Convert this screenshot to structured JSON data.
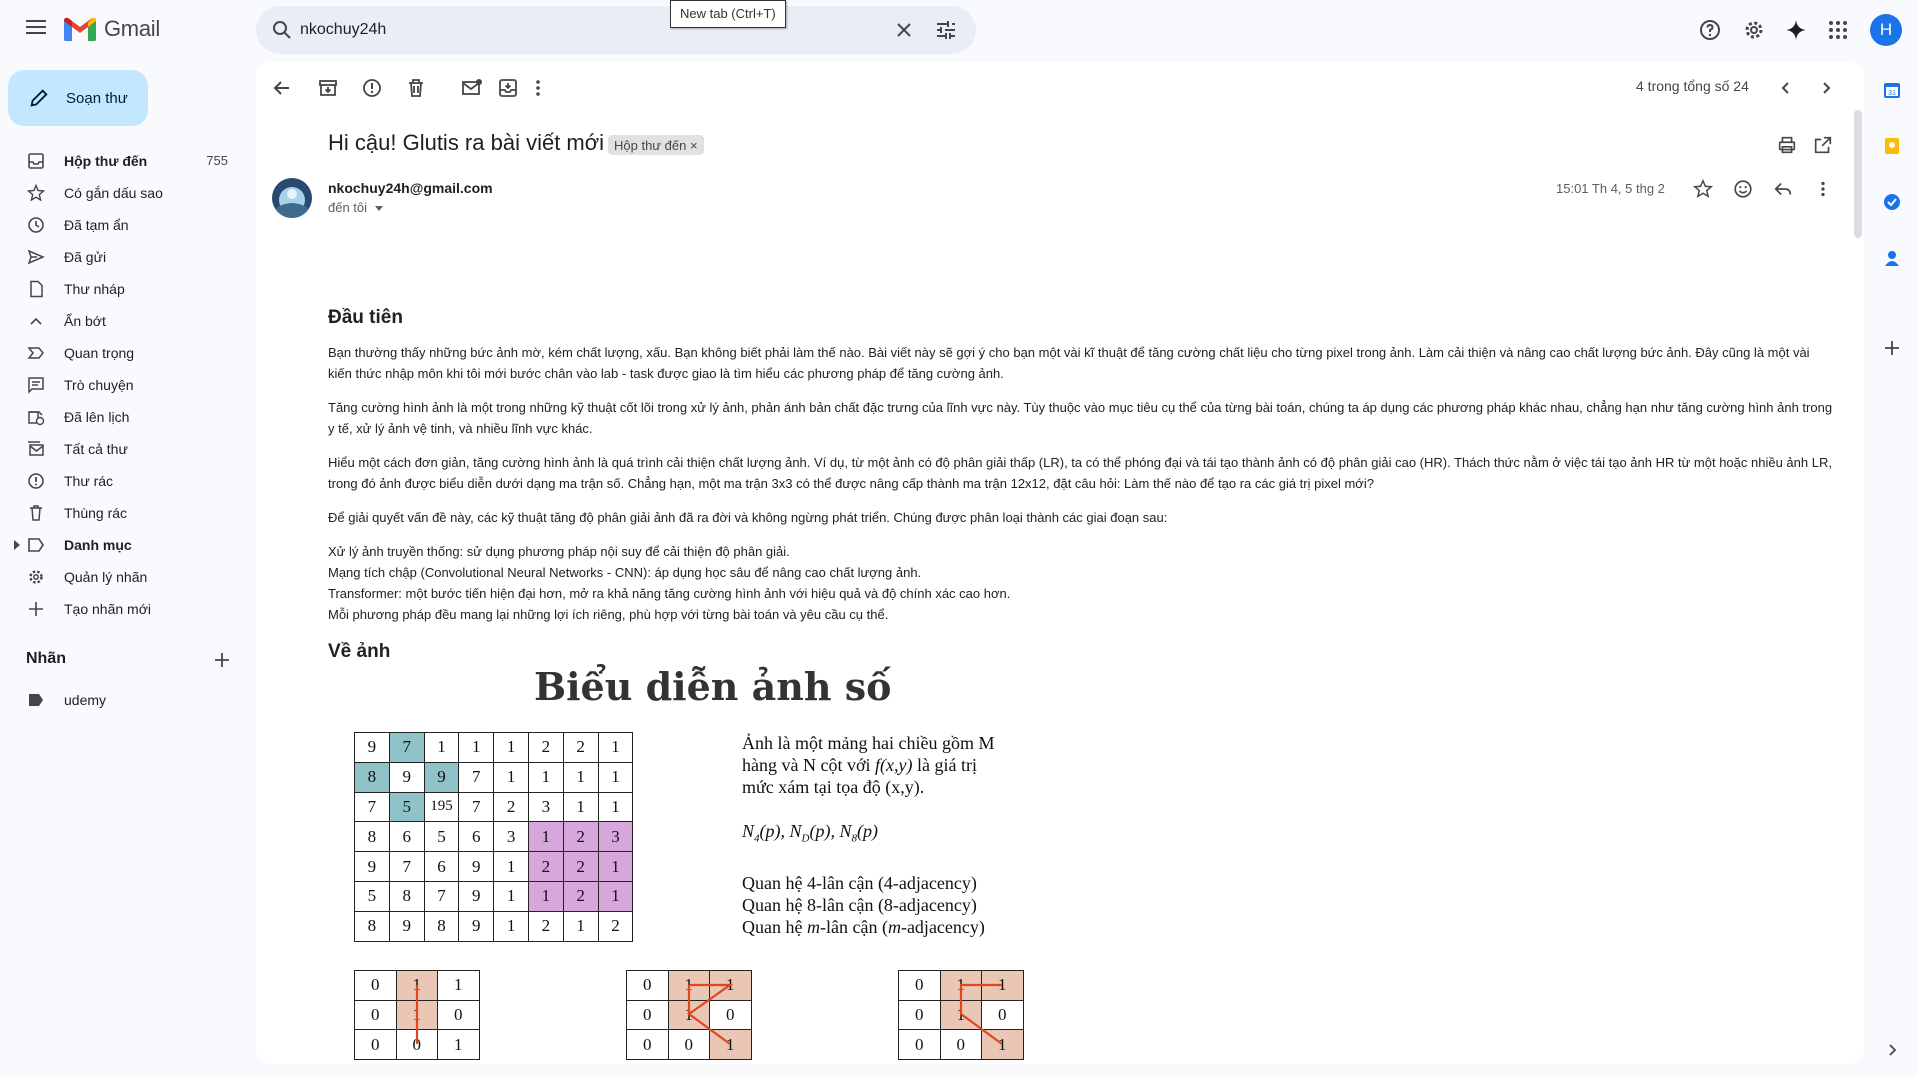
{
  "app": {
    "name": "Gmail"
  },
  "search": {
    "value": "nkochuy24h"
  },
  "tooltip": {
    "text": "New tab (Ctrl+T)"
  },
  "account": {
    "initial": "H"
  },
  "compose": {
    "label": "Soạn thư"
  },
  "nav": {
    "items": [
      {
        "label": "Hộp thư đến",
        "count": "755",
        "icon": "inbox-icon"
      },
      {
        "label": "Có gắn dấu sao",
        "icon": "star-icon"
      },
      {
        "label": "Đã tạm ẩn",
        "icon": "clock-icon"
      },
      {
        "label": "Đã gửi",
        "icon": "send-icon"
      },
      {
        "label": "Thư nháp",
        "icon": "draft-icon"
      },
      {
        "label": "Ẩn bớt",
        "icon": "chevron-up-icon"
      },
      {
        "label": "Quan trọng",
        "icon": "important-icon"
      },
      {
        "label": "Trò chuyện",
        "icon": "chat-icon"
      },
      {
        "label": "Đã lên lịch",
        "icon": "scheduled-icon"
      },
      {
        "label": "Tất cả thư",
        "icon": "all-mail-icon"
      },
      {
        "label": "Thư rác",
        "icon": "spam-icon"
      },
      {
        "label": "Thùng rác",
        "icon": "trash-icon"
      },
      {
        "label": "Danh mục",
        "icon": "label-icon"
      },
      {
        "label": "Quản lý nhãn",
        "icon": "gear-icon"
      },
      {
        "label": "Tạo nhãn mới",
        "icon": "plus-icon"
      }
    ]
  },
  "labels": {
    "heading": "Nhãn",
    "items": [
      {
        "label": "udemy"
      }
    ]
  },
  "toolbar": {
    "pager": "4 trong tổng số 24"
  },
  "email": {
    "subject": "Hi cậu! Glutis ra bài viết mới",
    "chip": "Hộp thư đến",
    "chip_close": "×",
    "sender": "nkochuy24h@gmail.com",
    "to": "đến tôi",
    "date": "15:01 Th 4, 5 thg 2",
    "heading1": "Đầu tiên",
    "p1": "Bạn thường thấy những bức ảnh mờ, kém chất lượng, xấu. Bạn không biết phải làm thế nào. Bài viết này sẽ gợi ý cho bạn một vài kĩ thuật để tăng cường chất liệu cho từng pixel trong ảnh. Làm cải thiện và nâng cao chất lượng bức ảnh. Đây cũng là một vài kiến thức nhập môn khi tôi mới bước chân vào lab - task được giao là tìm hiểu các phương pháp để tăng cường ảnh.",
    "p2": "Tăng cường hình ảnh là một trong những kỹ thuật cốt lõi trong xử lý ảnh, phản ánh bản chất đặc trưng của lĩnh vực này. Tùy thuộc vào mục tiêu cụ thể của từng bài toán, chúng ta áp dụng các phương pháp khác nhau, chẳng hạn như tăng cường hình ảnh trong y tế, xử lý ảnh vệ tinh, và nhiều lĩnh vực khác.",
    "p3": "Hiểu một cách đơn giản, tăng cường hình ảnh là quá trình cải thiện chất lượng ảnh. Ví dụ, từ một ảnh có độ phân giải thấp (LR), ta có thể phóng đại và tái tạo thành ảnh có độ phân giải cao (HR). Thách thức nằm ở việc tái tạo ảnh HR từ một hoặc nhiều ảnh LR, trong đó ảnh được biểu diễn dưới dạng ma trận số. Chẳng hạn, một ma trận 3x3 có thể được nâng cấp thành ma trận 12x12, đặt câu hỏi: Làm thế nào để tạo ra các giá trị pixel mới?",
    "p4": "Để giải quyết vấn đề này, các kỹ thuật tăng độ phân giải ảnh đã ra đời và không ngừng phát triển. Chúng được phân loại thành các giai đoạn sau:",
    "list": [
      "Xử lý ảnh truyền thống: sử dụng phương pháp nội suy để cải thiện độ phân giải.",
      "Mạng tích chập (Convolutional Neural Networks - CNN): áp dụng học sâu để nâng cao chất lượng ảnh.",
      "Transformer: một bước tiến hiện đại hơn, mở ra khả năng tăng cường hình ảnh với hiệu quả và độ chính xác cao hơn.",
      "Mỗi phương pháp đều mang lại những lợi ích riêng, phù hợp với từng bài toán và yêu cầu cụ thể."
    ],
    "heading2": "Về ảnh"
  },
  "figure": {
    "title": "Biểu diễn ảnh số",
    "grid": [
      [
        "9",
        "7",
        "1",
        "1",
        "1",
        "2",
        "2",
        "1"
      ],
      [
        "8",
        "9",
        "9",
        "7",
        "1",
        "1",
        "1",
        "1"
      ],
      [
        "7",
        "5",
        "195",
        "7",
        "2",
        "3",
        "1",
        "1"
      ],
      [
        "8",
        "6",
        "5",
        "6",
        "3",
        "1",
        "2",
        "3"
      ],
      [
        "9",
        "7",
        "6",
        "9",
        "1",
        "2",
        "2",
        "1"
      ],
      [
        "5",
        "8",
        "7",
        "9",
        "1",
        "1",
        "2",
        "1"
      ],
      [
        "8",
        "9",
        "8",
        "9",
        "1",
        "2",
        "1",
        "2"
      ]
    ],
    "highlight_teal": "#8fc3c8",
    "highlight_purple": "#d7a7dc",
    "highlight_tan": "#e9c7b4",
    "text_line1": "Ảnh là một mảng hai chiều gồm M",
    "text_line2_a": "hàng và N cột với ",
    "text_line2_b": "f(x,y)",
    "text_line2_c": " là giá trị",
    "text_line3": "mức xám tại tọa độ (x,y).",
    "neighborhoods": "N4(p), ND(p), N8(p)",
    "adj1": "Quan hệ 4-lân cận (4-adjacency)",
    "adj2": "Quan hệ 8-lân cận (8-adjacency)",
    "adj3_a": "Quan hệ ",
    "adj3_m": "m",
    "adj3_b": "-lân cận (",
    "adj3_c": "-adjacency)",
    "small_grid": [
      [
        "0",
        "1",
        "1"
      ],
      [
        "0",
        "1",
        "0"
      ],
      [
        "0",
        "0",
        "1"
      ]
    ]
  }
}
